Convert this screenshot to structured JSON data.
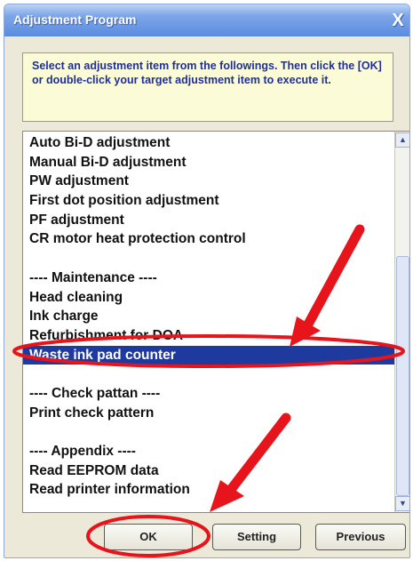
{
  "window": {
    "title": "Adjustment Program",
    "close_glyph": "X"
  },
  "instruction": "Select an adjustment item from the followings. Then click the [OK] or double-click your target adjustment item to execute it.",
  "list": {
    "items": [
      {
        "label": "Auto Bi-D adjustment"
      },
      {
        "label": "Manual Bi-D adjustment"
      },
      {
        "label": "PW adjustment"
      },
      {
        "label": "First dot position adjustment"
      },
      {
        "label": "PF adjustment"
      },
      {
        "label": "CR motor heat protection control"
      },
      {
        "label": ""
      },
      {
        "label": "---- Maintenance ----"
      },
      {
        "label": "Head cleaning"
      },
      {
        "label": "Ink charge"
      },
      {
        "label": "Refurbishment for DOA"
      },
      {
        "label": "Waste ink pad counter",
        "selected": true
      },
      {
        "label": ""
      },
      {
        "label": "---- Check pattan ----"
      },
      {
        "label": "Print check pattern"
      },
      {
        "label": ""
      },
      {
        "label": "---- Appendix ----"
      },
      {
        "label": "Read EEPROM data"
      },
      {
        "label": "Read printer information"
      }
    ]
  },
  "buttons": {
    "ok": "OK",
    "setting": "Setting",
    "previous": "Previous"
  },
  "annotation_color": "#e8141c"
}
